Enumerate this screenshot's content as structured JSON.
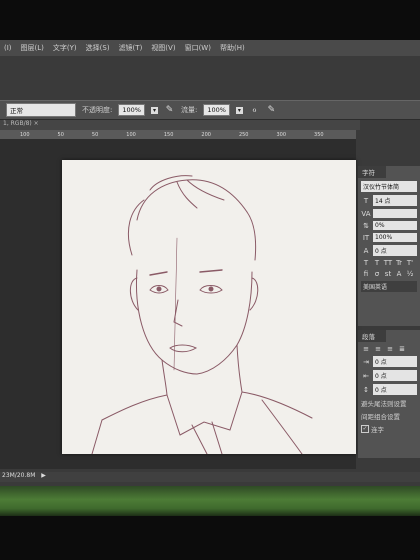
{
  "menubar": {
    "items": [
      "(I)",
      "图层(L)",
      "文字(Y)",
      "选择(S)",
      "滤镜(T)",
      "视图(V)",
      "窗口(W)",
      "帮助(H)"
    ]
  },
  "options": {
    "mode_value": "正常",
    "opacity_label": "不透明度:",
    "opacity_value": "100%",
    "flow_label": "流量:",
    "flow_value": "100%"
  },
  "document": {
    "tab_label": "1, RGB/8) ×",
    "ruler_ticks": [
      "100",
      "50",
      "50",
      "100",
      "150",
      "200",
      "250",
      "300",
      "350"
    ],
    "status_text": "23M/20.8M"
  },
  "character_panel": {
    "tab": "字符",
    "font_family": "汉仪竹节体简",
    "font_size": "14 点",
    "tracking_label": "VA",
    "scale_percent": "0%",
    "vertical_scale": "100%",
    "baseline_shift": "0 点",
    "style_buttons": [
      "T",
      "T",
      "TT",
      "Tr",
      "T'",
      "T,",
      "T",
      "T"
    ],
    "ligature_buttons": [
      "fi",
      "σ",
      "st",
      "A",
      "ad",
      "T",
      "1st",
      "½"
    ],
    "language": "美国英语"
  },
  "paragraph_panel": {
    "tab": "段落",
    "indent_left": "0 点",
    "indent_first": "0 点",
    "space_before": "0 点",
    "hyphenation_label": "避头尾法则设置",
    "composer_label": "间距组合设置",
    "hyphenate_label": "连字"
  }
}
